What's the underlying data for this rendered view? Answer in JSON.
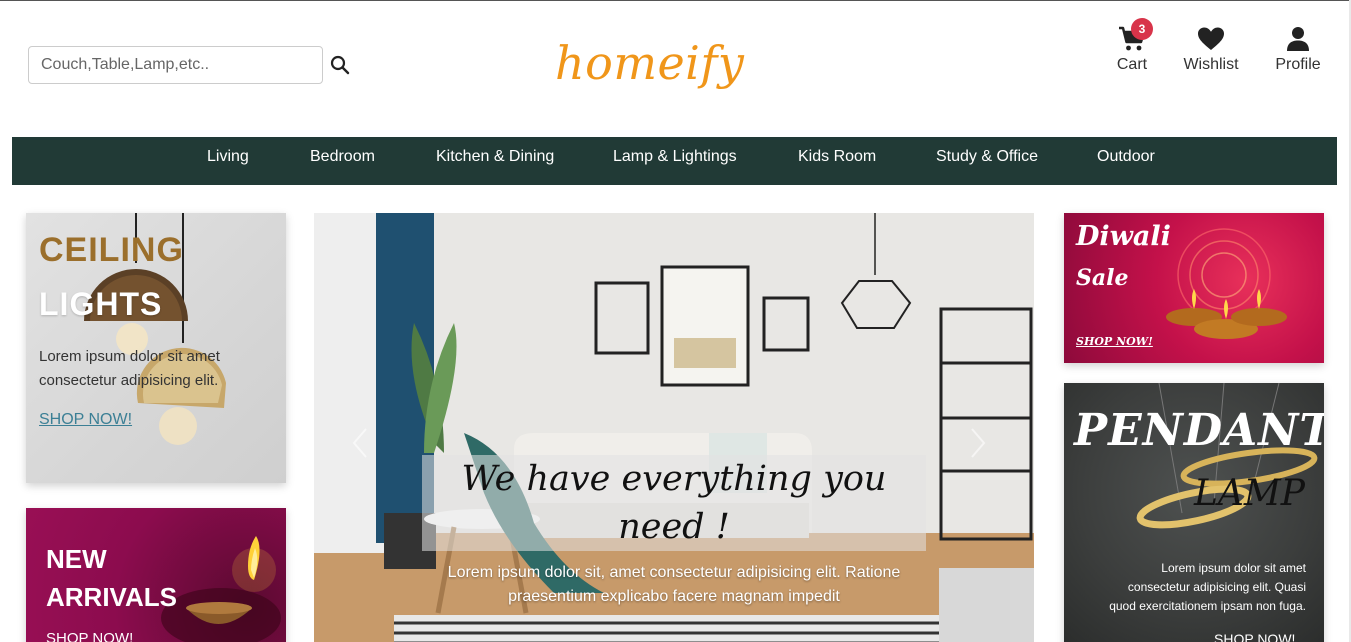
{
  "header": {
    "search_placeholder": "Couch,Table,Lamp,etc..",
    "logo": "homeify",
    "cart_label": "Cart",
    "cart_count": "3",
    "wishlist_label": "Wishlist",
    "profile_label": "Profile"
  },
  "nav": {
    "items": [
      "Living",
      "Bedroom",
      "Kitchen & Dining",
      "Lamp & Lightings",
      "Kids Room",
      "Study & Office",
      "Outdoor"
    ]
  },
  "promo_left": {
    "ceiling_title_1": "CEILING",
    "ceiling_title_2": "LIGHTS",
    "ceiling_text": "Lorem ipsum dolor sit amet consectetur adipisicing elit.",
    "ceiling_shop": "SHOP NOW!",
    "new_title_1": "NEW",
    "new_title_2": "ARRIVALS",
    "new_shop": "SHOP NOW!"
  },
  "hero": {
    "headline": "We have everything you need !",
    "subtext": "Lorem ipsum dolor sit, amet consectetur adipisicing elit. Ratione praesentium explicabo facere magnam impedit"
  },
  "promo_right": {
    "diwali_title_1": "Diwali",
    "diwali_title_2": "Sale",
    "diwali_shop": "SHOP NOW!",
    "pendant_title_1": "PENDANT",
    "pendant_title_2": "LAMP",
    "pendant_text": "Lorem ipsum dolor sit amet consectetur adipisicing elit. Quasi quod exercitationem ipsam non fuga.",
    "pendant_shop": "SHOP NOW!"
  },
  "colors": {
    "logo": "#f0961a",
    "nav_bg": "#213a36",
    "badge": "#d8344a",
    "ceiling_title": "#9b6f2c",
    "new_arrivals_bg": "#990f55",
    "diwali_bg": "#c4114a"
  },
  "icons": [
    "search-icon",
    "cart-icon",
    "heart-icon",
    "user-icon",
    "chevron-left-icon",
    "chevron-right-icon"
  ]
}
